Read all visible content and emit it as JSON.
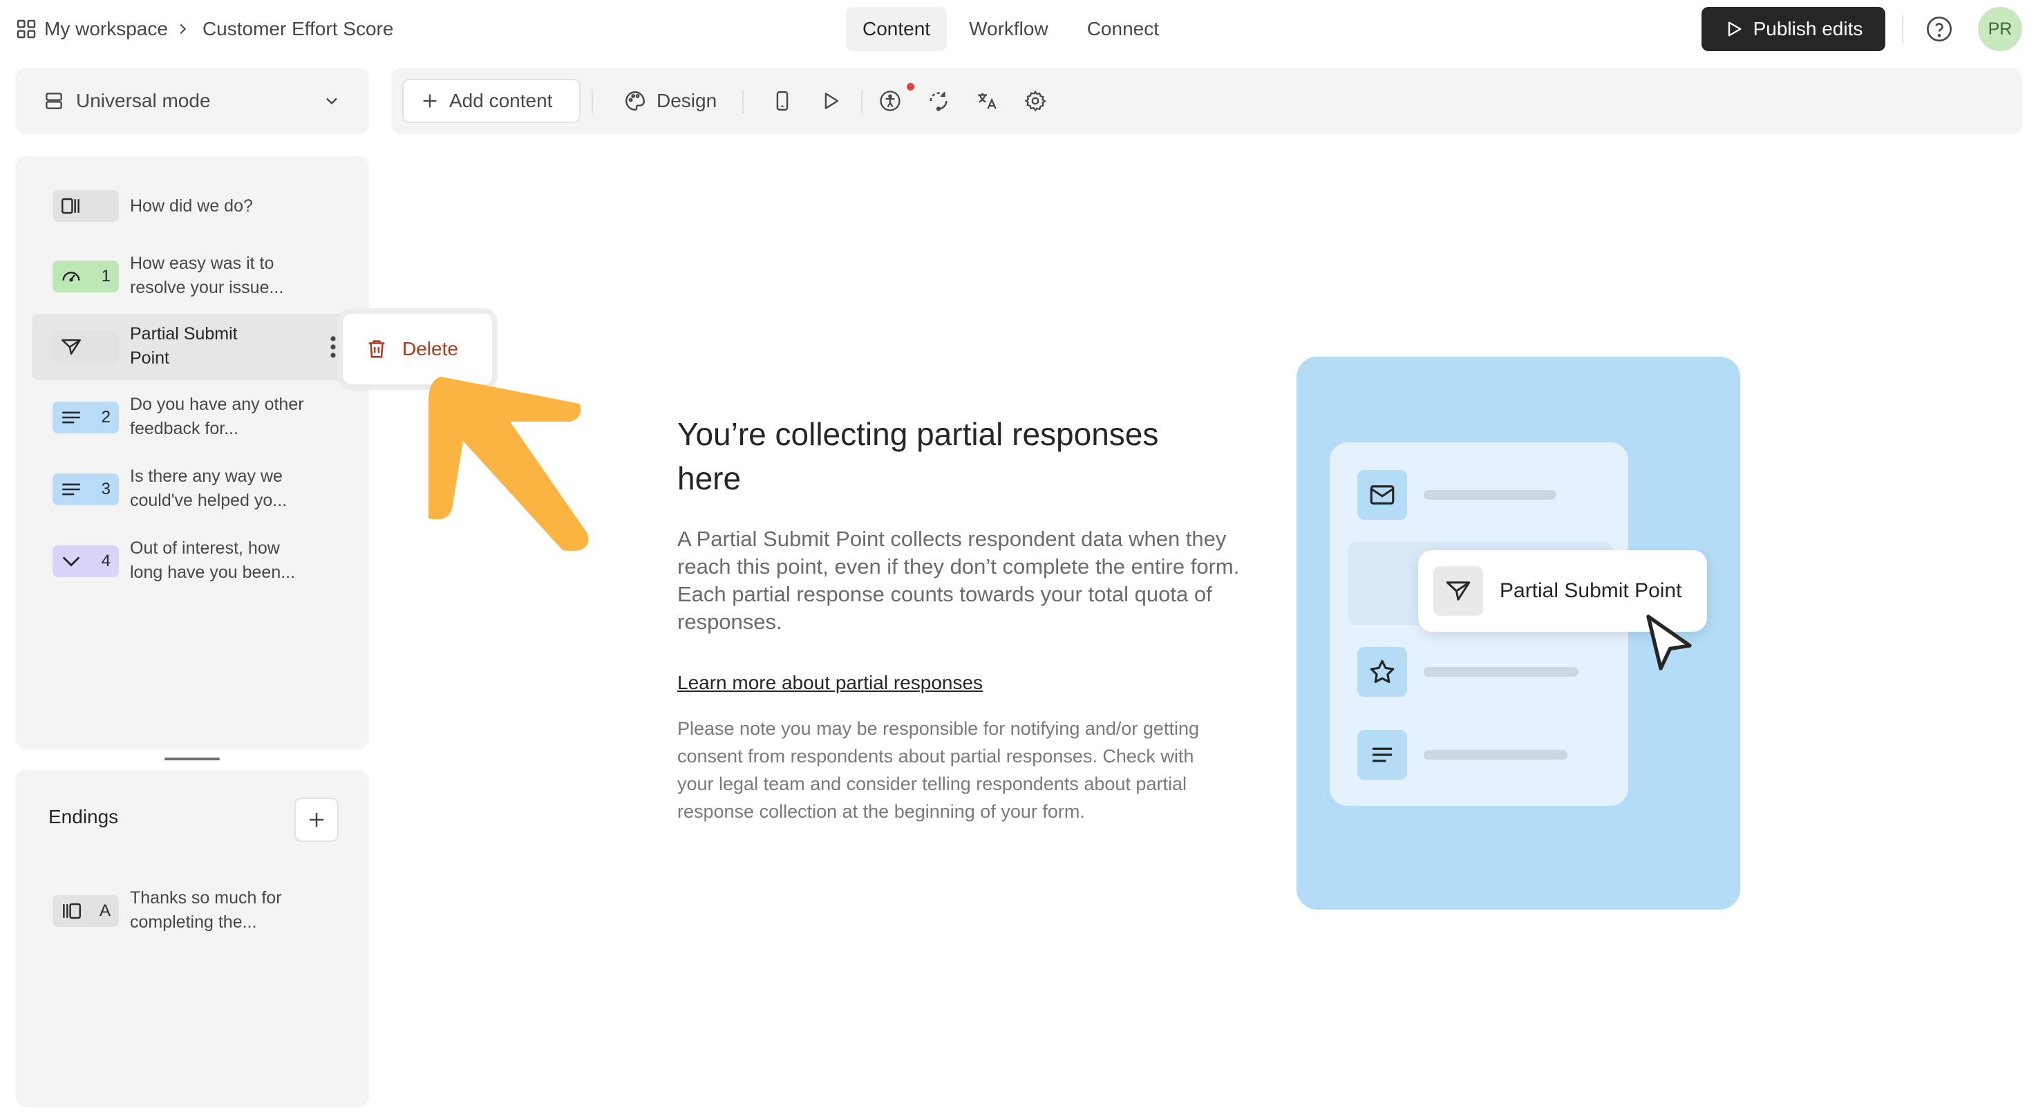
{
  "header": {
    "workspace_label": "My workspace",
    "form_title": "Customer Effort Score",
    "tabs": [
      {
        "label": "Content",
        "active": true
      },
      {
        "label": "Workflow",
        "active": false
      },
      {
        "label": "Connect",
        "active": false
      }
    ],
    "publish_label": "Publish edits",
    "avatar_initials": "PR"
  },
  "mode": {
    "label": "Universal mode"
  },
  "toolbar": {
    "add_content_label": "Add content",
    "design_label": "Design",
    "icons": [
      "mobile-preview-icon",
      "play-icon",
      "accessibility-icon",
      "logic-icon",
      "translate-icon",
      "settings-icon"
    ]
  },
  "questions": [
    {
      "text": "How did we do?",
      "badge_color": "#e2e2e2",
      "number": "",
      "icon": "welcome-screen-icon"
    },
    {
      "text": "How easy was it to resolve your issue...",
      "badge_color": "#bde7b5",
      "number": "1",
      "icon": "gauge-icon"
    },
    {
      "text": "Partial Submit Point",
      "badge_color": "#e2e2e2",
      "number": "",
      "icon": "send-icon",
      "selected": true
    },
    {
      "text": "Do you have any other feedback for...",
      "badge_color": "#b8dcf8",
      "number": "2",
      "icon": "long-text-icon"
    },
    {
      "text": "Is there any way we could've helped yo...",
      "badge_color": "#b8dcf8",
      "number": "3",
      "icon": "long-text-icon"
    },
    {
      "text": "Out of interest, how long have you been...",
      "badge_color": "#dcd4f8",
      "number": "4",
      "icon": "dropdown-icon"
    }
  ],
  "endings": {
    "title": "Endings",
    "items": [
      {
        "text": "Thanks so much for completing the...",
        "badge_color": "#e2e2e2",
        "letter": "A",
        "icon": "ending-screen-icon"
      }
    ]
  },
  "popup": {
    "delete_label": "Delete"
  },
  "main": {
    "title": "You’re collecting partial responses here",
    "description": "A Partial Submit Point collects respondent data when they reach this point, even if they don’t complete the entire form. Each partial response counts towards your total quota of responses.",
    "link_label": "Learn more about partial responses",
    "note": "Please note you may be responsible for notifying and/or getting consent from respondents about partial responses. Check with your legal team and consider telling respondents about partial response collection at the beginning of your form."
  },
  "illustration": {
    "chip_label": "Partial Submit Point"
  },
  "colors": {
    "accent_dark": "#262627",
    "delete_red": "#b03a1e",
    "arrow_orange": "#fbb441",
    "illustration_blue": "#b3dcf7"
  }
}
